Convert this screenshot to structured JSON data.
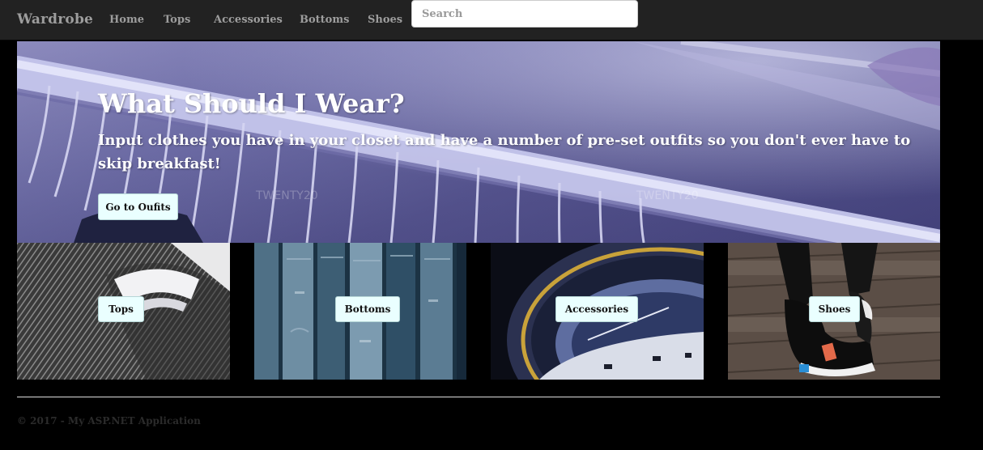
{
  "nav": {
    "brand": "Wardrobe",
    "links": [
      "Home",
      "Tops",
      "Accessories",
      "Bottoms",
      "Shoes"
    ],
    "search_placeholder": "Search"
  },
  "hero": {
    "title": "What Should I Wear?",
    "subtitle": "Input clothes you have in your closet and have a number of pre-set outfits so you don't ever have to skip breakfast!",
    "button": "Go to Oufits",
    "watermark": "TWENTY20"
  },
  "tiles": [
    {
      "label": "Tops",
      "image": "striped-shirt-collar"
    },
    {
      "label": "Bottoms",
      "image": "hanging-jeans"
    },
    {
      "label": "Accessories",
      "image": "watch-bezel"
    },
    {
      "label": "Shoes",
      "image": "sneakers-on-deck"
    }
  ],
  "footer": {
    "text": "© 2017 - My ASP.NET Application"
  }
}
